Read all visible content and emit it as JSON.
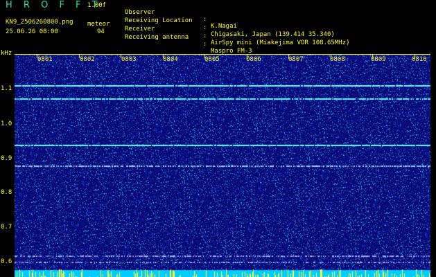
{
  "app": {
    "name": "H R O F F T",
    "version": "1.00f"
  },
  "file": {
    "name": "KN9_2506260800.png",
    "timestamp": "25.06.26 08:00"
  },
  "meteor": {
    "label": "meteor",
    "count": "94"
  },
  "info": [
    {
      "key": "Observer",
      "value": "K.Nagai"
    },
    {
      "key": "Receiving Location",
      "value": "Chigasaki, Japan (139.414 35.340)"
    },
    {
      "key": "Receiver",
      "value": "AirSpy mini (Miakejima VOR 108.65MHz)"
    },
    {
      "key": "Receiving antenna",
      "value": "Maspro FM-3"
    }
  ],
  "axis": {
    "y_unit": "kHz",
    "y_ticks": [
      "1.1",
      "1.0",
      "0.9",
      "0.8",
      "0.7",
      "0.6"
    ],
    "x_ticks": [
      "0801",
      "0802",
      "0803",
      "0804",
      "0805",
      "0806",
      "0807",
      "0808",
      "0809",
      "0810"
    ]
  },
  "colors": {
    "text": "#ffff33",
    "title": "#33dd99",
    "background": "#0a0a6e",
    "signal": "#66ffff"
  }
}
